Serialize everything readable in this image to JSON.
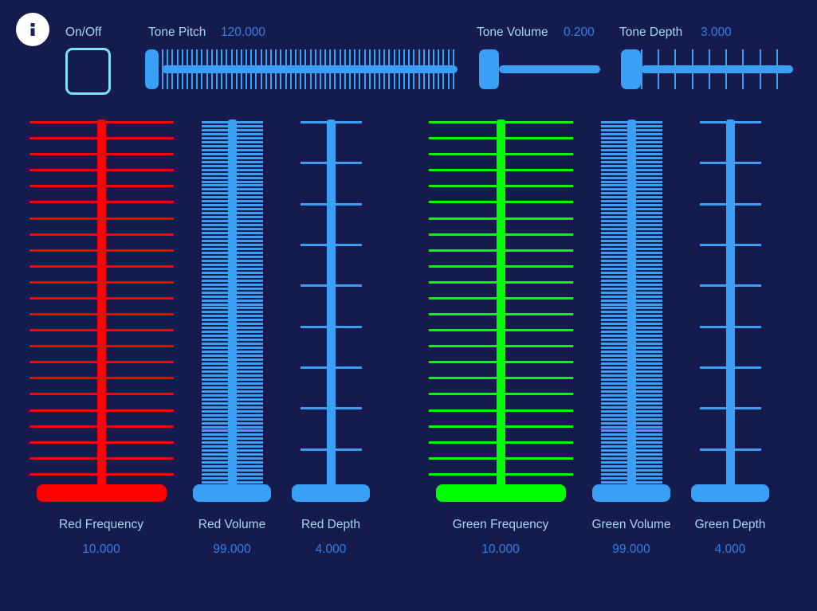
{
  "app": {
    "background_color": "#161b4e",
    "accent_blue": "#3aa0f5",
    "label_color": "#9fd8ee",
    "value_color": "#2e7fe8",
    "red_color": "#ff0000",
    "green_color": "#00ff00"
  },
  "header": {
    "info_icon": "info-icon",
    "onoff": {
      "label": "On/Off",
      "checked": false
    },
    "tone_pitch": {
      "label": "Tone Pitch",
      "value": "120.000",
      "ticks": 60,
      "thumb_percent": 0
    },
    "tone_volume": {
      "label": "Tone Volume",
      "value": "0.200",
      "ticks": 0,
      "thumb_percent": 0
    },
    "tone_depth": {
      "label": "Tone Depth",
      "value": "3.000",
      "ticks": 9,
      "thumb_percent": 0
    }
  },
  "sliders": [
    {
      "name": "red-frequency",
      "label": "Red Frequency",
      "value": "10.000",
      "color": "#ff0000",
      "ticks": 23,
      "tick_width": 85,
      "thumb_width": 163,
      "thumb_percent": 0
    },
    {
      "name": "red-volume",
      "label": "Red Volume",
      "value": "99.000",
      "color": "#3aa0f5",
      "ticks": 93,
      "tick_width": 33,
      "thumb_width": 98,
      "thumb_percent": 0
    },
    {
      "name": "red-depth",
      "label": "Red Depth",
      "value": "4.000",
      "color": "#3aa0f5",
      "ticks": 9,
      "tick_width": 33,
      "thumb_width": 98,
      "thumb_percent": 0
    },
    {
      "name": "green-frequency",
      "label": "Green Frequency",
      "value": "10.000",
      "color": "#00ff00",
      "ticks": 23,
      "tick_width": 85,
      "thumb_width": 163,
      "thumb_percent": 0
    },
    {
      "name": "green-volume",
      "label": "Green Volume",
      "value": "99.000",
      "color": "#3aa0f5",
      "ticks": 93,
      "tick_width": 33,
      "thumb_width": 98,
      "thumb_percent": 0
    },
    {
      "name": "green-depth",
      "label": "Green Depth",
      "value": "4.000",
      "color": "#3aa0f5",
      "ticks": 9,
      "tick_width": 33,
      "thumb_width": 98,
      "thumb_percent": 0
    }
  ]
}
